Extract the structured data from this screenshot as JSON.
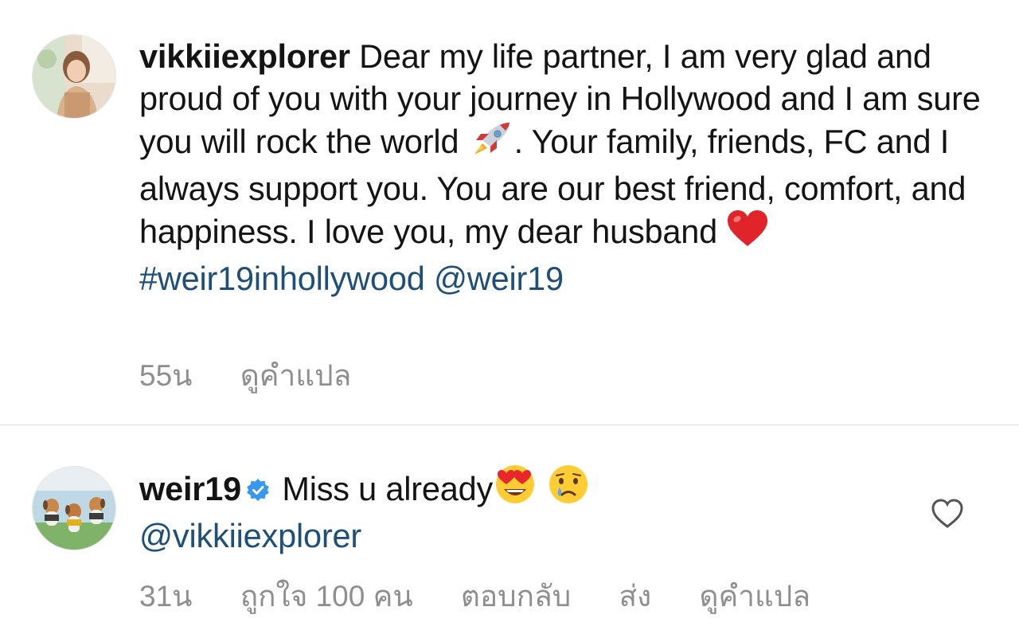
{
  "comments": [
    {
      "username": "vikkiiexplorer",
      "text_part1": "Dear my life partner, I am very glad and proud of you with your journey in Hollywood and I am sure you will rock the world",
      "emoji1": "rocket",
      "text_part2": ". Your family, friends, FC and I always support you. You are our best friend, comfort, and happiness. I love you, my dear husband",
      "emoji2": "red-heart",
      "hashtag": "#weir19inhollywood",
      "mention": "@weir19",
      "time": "55น",
      "translate": "ดูคำแปล"
    },
    {
      "username": "weir19",
      "verified": true,
      "text": "Miss u already",
      "emoji1": "heart-eyes-face",
      "emoji2": "crying-face",
      "mention": "@vikkiiexplorer",
      "time": "31น",
      "likes": "ถูกใจ 100 คน",
      "reply": "ตอบกลับ",
      "send": "ส่ง",
      "translate": "ดูคำแปล"
    }
  ],
  "colors": {
    "link": "#1d4f7a",
    "meta": "#8e8e8e",
    "verified": "#3897f0"
  }
}
